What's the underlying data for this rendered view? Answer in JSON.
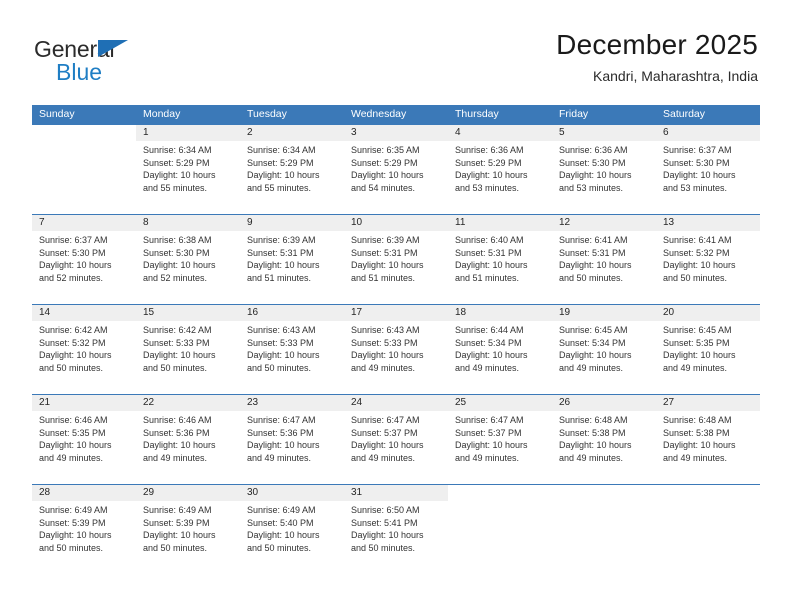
{
  "brand": {
    "name_part1": "General",
    "name_part2": "Blue",
    "triangle_color": "#1f6fb5",
    "blue_color": "#1f7ec4"
  },
  "header": {
    "title": "December 2025",
    "subtitle": "Kandri, Maharashtra, India"
  },
  "theme": {
    "header_bg": "#3b79b8",
    "header_text": "#ffffff",
    "daynum_bg": "#efefef",
    "cell_bg": "#ffffff",
    "separator": "#3b79b8"
  },
  "calendar": {
    "weekday_headers": [
      "Sunday",
      "Monday",
      "Tuesday",
      "Wednesday",
      "Thursday",
      "Friday",
      "Saturday"
    ],
    "weeks": [
      {
        "days": [
          {
            "num": "",
            "sunrise": "",
            "sunset": "",
            "daylight1": "",
            "daylight2": ""
          },
          {
            "num": "1",
            "sunrise": "Sunrise: 6:34 AM",
            "sunset": "Sunset: 5:29 PM",
            "daylight1": "Daylight: 10 hours",
            "daylight2": "and 55 minutes."
          },
          {
            "num": "2",
            "sunrise": "Sunrise: 6:34 AM",
            "sunset": "Sunset: 5:29 PM",
            "daylight1": "Daylight: 10 hours",
            "daylight2": "and 55 minutes."
          },
          {
            "num": "3",
            "sunrise": "Sunrise: 6:35 AM",
            "sunset": "Sunset: 5:29 PM",
            "daylight1": "Daylight: 10 hours",
            "daylight2": "and 54 minutes."
          },
          {
            "num": "4",
            "sunrise": "Sunrise: 6:36 AM",
            "sunset": "Sunset: 5:29 PM",
            "daylight1": "Daylight: 10 hours",
            "daylight2": "and 53 minutes."
          },
          {
            "num": "5",
            "sunrise": "Sunrise: 6:36 AM",
            "sunset": "Sunset: 5:30 PM",
            "daylight1": "Daylight: 10 hours",
            "daylight2": "and 53 minutes."
          },
          {
            "num": "6",
            "sunrise": "Sunrise: 6:37 AM",
            "sunset": "Sunset: 5:30 PM",
            "daylight1": "Daylight: 10 hours",
            "daylight2": "and 53 minutes."
          }
        ]
      },
      {
        "days": [
          {
            "num": "7",
            "sunrise": "Sunrise: 6:37 AM",
            "sunset": "Sunset: 5:30 PM",
            "daylight1": "Daylight: 10 hours",
            "daylight2": "and 52 minutes."
          },
          {
            "num": "8",
            "sunrise": "Sunrise: 6:38 AM",
            "sunset": "Sunset: 5:30 PM",
            "daylight1": "Daylight: 10 hours",
            "daylight2": "and 52 minutes."
          },
          {
            "num": "9",
            "sunrise": "Sunrise: 6:39 AM",
            "sunset": "Sunset: 5:31 PM",
            "daylight1": "Daylight: 10 hours",
            "daylight2": "and 51 minutes."
          },
          {
            "num": "10",
            "sunrise": "Sunrise: 6:39 AM",
            "sunset": "Sunset: 5:31 PM",
            "daylight1": "Daylight: 10 hours",
            "daylight2": "and 51 minutes."
          },
          {
            "num": "11",
            "sunrise": "Sunrise: 6:40 AM",
            "sunset": "Sunset: 5:31 PM",
            "daylight1": "Daylight: 10 hours",
            "daylight2": "and 51 minutes."
          },
          {
            "num": "12",
            "sunrise": "Sunrise: 6:41 AM",
            "sunset": "Sunset: 5:31 PM",
            "daylight1": "Daylight: 10 hours",
            "daylight2": "and 50 minutes."
          },
          {
            "num": "13",
            "sunrise": "Sunrise: 6:41 AM",
            "sunset": "Sunset: 5:32 PM",
            "daylight1": "Daylight: 10 hours",
            "daylight2": "and 50 minutes."
          }
        ]
      },
      {
        "days": [
          {
            "num": "14",
            "sunrise": "Sunrise: 6:42 AM",
            "sunset": "Sunset: 5:32 PM",
            "daylight1": "Daylight: 10 hours",
            "daylight2": "and 50 minutes."
          },
          {
            "num": "15",
            "sunrise": "Sunrise: 6:42 AM",
            "sunset": "Sunset: 5:33 PM",
            "daylight1": "Daylight: 10 hours",
            "daylight2": "and 50 minutes."
          },
          {
            "num": "16",
            "sunrise": "Sunrise: 6:43 AM",
            "sunset": "Sunset: 5:33 PM",
            "daylight1": "Daylight: 10 hours",
            "daylight2": "and 50 minutes."
          },
          {
            "num": "17",
            "sunrise": "Sunrise: 6:43 AM",
            "sunset": "Sunset: 5:33 PM",
            "daylight1": "Daylight: 10 hours",
            "daylight2": "and 49 minutes."
          },
          {
            "num": "18",
            "sunrise": "Sunrise: 6:44 AM",
            "sunset": "Sunset: 5:34 PM",
            "daylight1": "Daylight: 10 hours",
            "daylight2": "and 49 minutes."
          },
          {
            "num": "19",
            "sunrise": "Sunrise: 6:45 AM",
            "sunset": "Sunset: 5:34 PM",
            "daylight1": "Daylight: 10 hours",
            "daylight2": "and 49 minutes."
          },
          {
            "num": "20",
            "sunrise": "Sunrise: 6:45 AM",
            "sunset": "Sunset: 5:35 PM",
            "daylight1": "Daylight: 10 hours",
            "daylight2": "and 49 minutes."
          }
        ]
      },
      {
        "days": [
          {
            "num": "21",
            "sunrise": "Sunrise: 6:46 AM",
            "sunset": "Sunset: 5:35 PM",
            "daylight1": "Daylight: 10 hours",
            "daylight2": "and 49 minutes."
          },
          {
            "num": "22",
            "sunrise": "Sunrise: 6:46 AM",
            "sunset": "Sunset: 5:36 PM",
            "daylight1": "Daylight: 10 hours",
            "daylight2": "and 49 minutes."
          },
          {
            "num": "23",
            "sunrise": "Sunrise: 6:47 AM",
            "sunset": "Sunset: 5:36 PM",
            "daylight1": "Daylight: 10 hours",
            "daylight2": "and 49 minutes."
          },
          {
            "num": "24",
            "sunrise": "Sunrise: 6:47 AM",
            "sunset": "Sunset: 5:37 PM",
            "daylight1": "Daylight: 10 hours",
            "daylight2": "and 49 minutes."
          },
          {
            "num": "25",
            "sunrise": "Sunrise: 6:47 AM",
            "sunset": "Sunset: 5:37 PM",
            "daylight1": "Daylight: 10 hours",
            "daylight2": "and 49 minutes."
          },
          {
            "num": "26",
            "sunrise": "Sunrise: 6:48 AM",
            "sunset": "Sunset: 5:38 PM",
            "daylight1": "Daylight: 10 hours",
            "daylight2": "and 49 minutes."
          },
          {
            "num": "27",
            "sunrise": "Sunrise: 6:48 AM",
            "sunset": "Sunset: 5:38 PM",
            "daylight1": "Daylight: 10 hours",
            "daylight2": "and 49 minutes."
          }
        ]
      },
      {
        "days": [
          {
            "num": "28",
            "sunrise": "Sunrise: 6:49 AM",
            "sunset": "Sunset: 5:39 PM",
            "daylight1": "Daylight: 10 hours",
            "daylight2": "and 50 minutes."
          },
          {
            "num": "29",
            "sunrise": "Sunrise: 6:49 AM",
            "sunset": "Sunset: 5:39 PM",
            "daylight1": "Daylight: 10 hours",
            "daylight2": "and 50 minutes."
          },
          {
            "num": "30",
            "sunrise": "Sunrise: 6:49 AM",
            "sunset": "Sunset: 5:40 PM",
            "daylight1": "Daylight: 10 hours",
            "daylight2": "and 50 minutes."
          },
          {
            "num": "31",
            "sunrise": "Sunrise: 6:50 AM",
            "sunset": "Sunset: 5:41 PM",
            "daylight1": "Daylight: 10 hours",
            "daylight2": "and 50 minutes."
          },
          {
            "num": "",
            "sunrise": "",
            "sunset": "",
            "daylight1": "",
            "daylight2": ""
          },
          {
            "num": "",
            "sunrise": "",
            "sunset": "",
            "daylight1": "",
            "daylight2": ""
          },
          {
            "num": "",
            "sunrise": "",
            "sunset": "",
            "daylight1": "",
            "daylight2": ""
          }
        ]
      }
    ]
  }
}
